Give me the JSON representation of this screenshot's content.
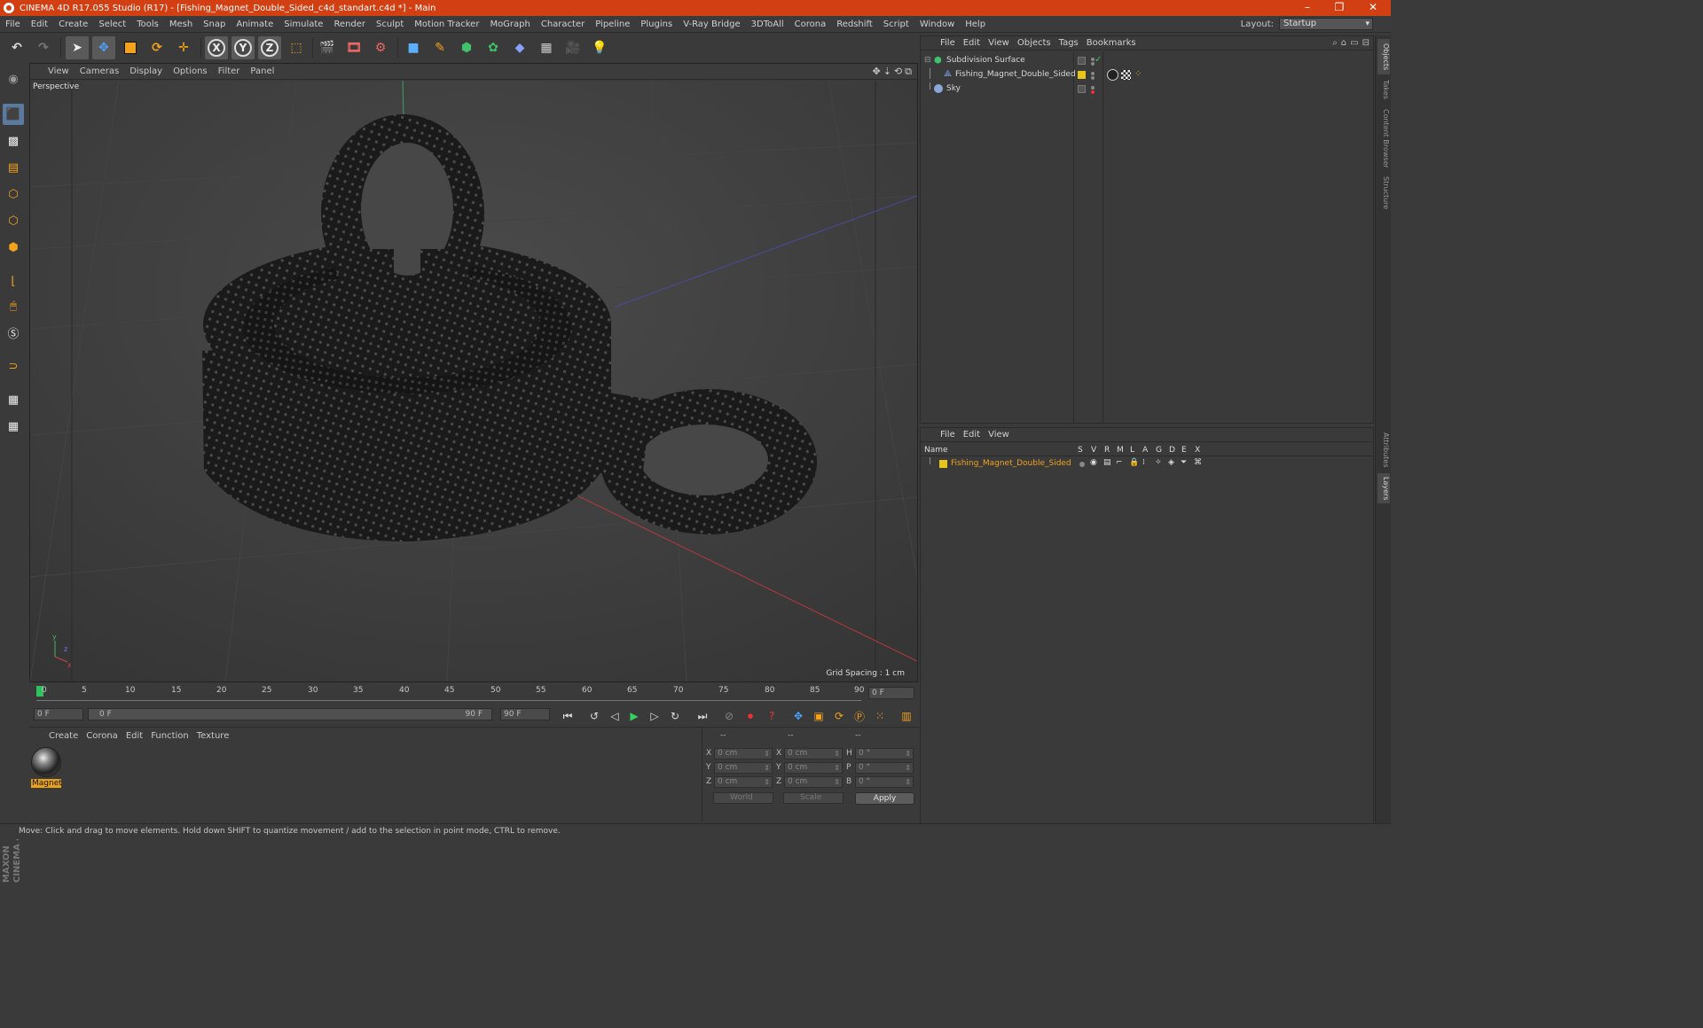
{
  "window": {
    "title": "CINEMA 4D R17.055 Studio (R17) - [Fishing_Magnet_Double_Sided_c4d_standart.c4d *] - Main",
    "minimize": "–",
    "restore": "❐",
    "close": "✕"
  },
  "menu": {
    "items": [
      "File",
      "Edit",
      "Create",
      "Select",
      "Tools",
      "Mesh",
      "Snap",
      "Animate",
      "Simulate",
      "Render",
      "Sculpt",
      "Motion Tracker",
      "MoGraph",
      "Character",
      "Pipeline",
      "Plugins",
      "V-Ray Bridge",
      "3DToAll",
      "Corona",
      "Redshift",
      "Script",
      "Window",
      "Help"
    ],
    "layout_label": "Layout:",
    "layout_value": "Startup"
  },
  "toolbar": {
    "axis_x": "X",
    "axis_y": "Y",
    "axis_z": "Z"
  },
  "viewport": {
    "menu": [
      "View",
      "Cameras",
      "Display",
      "Options",
      "Filter",
      "Panel"
    ],
    "label": "Perspective",
    "grid_spacing": "Grid Spacing : 1 cm",
    "controls": [
      "✥",
      "⇣",
      "⟲",
      "⧉"
    ]
  },
  "timeline": {
    "ticks": [
      "0",
      "5",
      "10",
      "15",
      "20",
      "25",
      "30",
      "35",
      "40",
      "45",
      "50",
      "55",
      "60",
      "65",
      "70",
      "75",
      "80",
      "85",
      "90"
    ],
    "current_frame_display": "0 F",
    "start_frame": "0 F",
    "range_start": "0 F",
    "range_end": "90 F",
    "end_frame": "90 F"
  },
  "material_manager": {
    "menu": [
      "Create",
      "Corona",
      "Edit",
      "Function",
      "Texture"
    ],
    "materials": [
      {
        "label": "Magnet"
      }
    ]
  },
  "coordinates": {
    "header": [
      "--",
      "--",
      "--"
    ],
    "pos": [
      {
        "axis": "X",
        "value": "0 cm"
      },
      {
        "axis": "Y",
        "value": "0 cm"
      },
      {
        "axis": "Z",
        "value": "0 cm"
      }
    ],
    "size": [
      {
        "axis": "X",
        "value": "0 cm"
      },
      {
        "axis": "Y",
        "value": "0 cm"
      },
      {
        "axis": "Z",
        "value": "0 cm"
      }
    ],
    "rot": [
      {
        "axis": "H",
        "value": "0 °"
      },
      {
        "axis": "P",
        "value": "0 °"
      },
      {
        "axis": "B",
        "value": "0 °"
      }
    ],
    "world": "World",
    "scale": "Scale",
    "apply": "Apply"
  },
  "object_manager": {
    "menu": [
      "File",
      "Edit",
      "View",
      "Objects",
      "Tags",
      "Bookmarks"
    ],
    "objects": [
      {
        "name": "Subdivision Surface"
      },
      {
        "name": "Fishing_Magnet_Double_Sided"
      },
      {
        "name": "Sky"
      }
    ]
  },
  "layer_manager": {
    "menu": [
      "File",
      "Edit",
      "View"
    ],
    "columns": [
      "Name",
      "S",
      "V",
      "R",
      "M",
      "L",
      "A",
      "G",
      "D",
      "E",
      "X"
    ],
    "layers": [
      {
        "name": "Fishing_Magnet_Double_Sided",
        "color": "#e8c51a"
      }
    ]
  },
  "right_tabs": [
    "Objects",
    "Takes",
    "Content Browser",
    "Structure",
    "Attributes",
    "Layers"
  ],
  "status": "Move: Click and drag to move elements. Hold down SHIFT to quantize movement / add to the selection in point mode, CTRL to remove.",
  "brand": "MAXON CINEMA 4D",
  "colors": {
    "title_bar": "#d13f12",
    "accent_orange": "#e8a21a",
    "layer_yellow": "#e8c51a"
  }
}
